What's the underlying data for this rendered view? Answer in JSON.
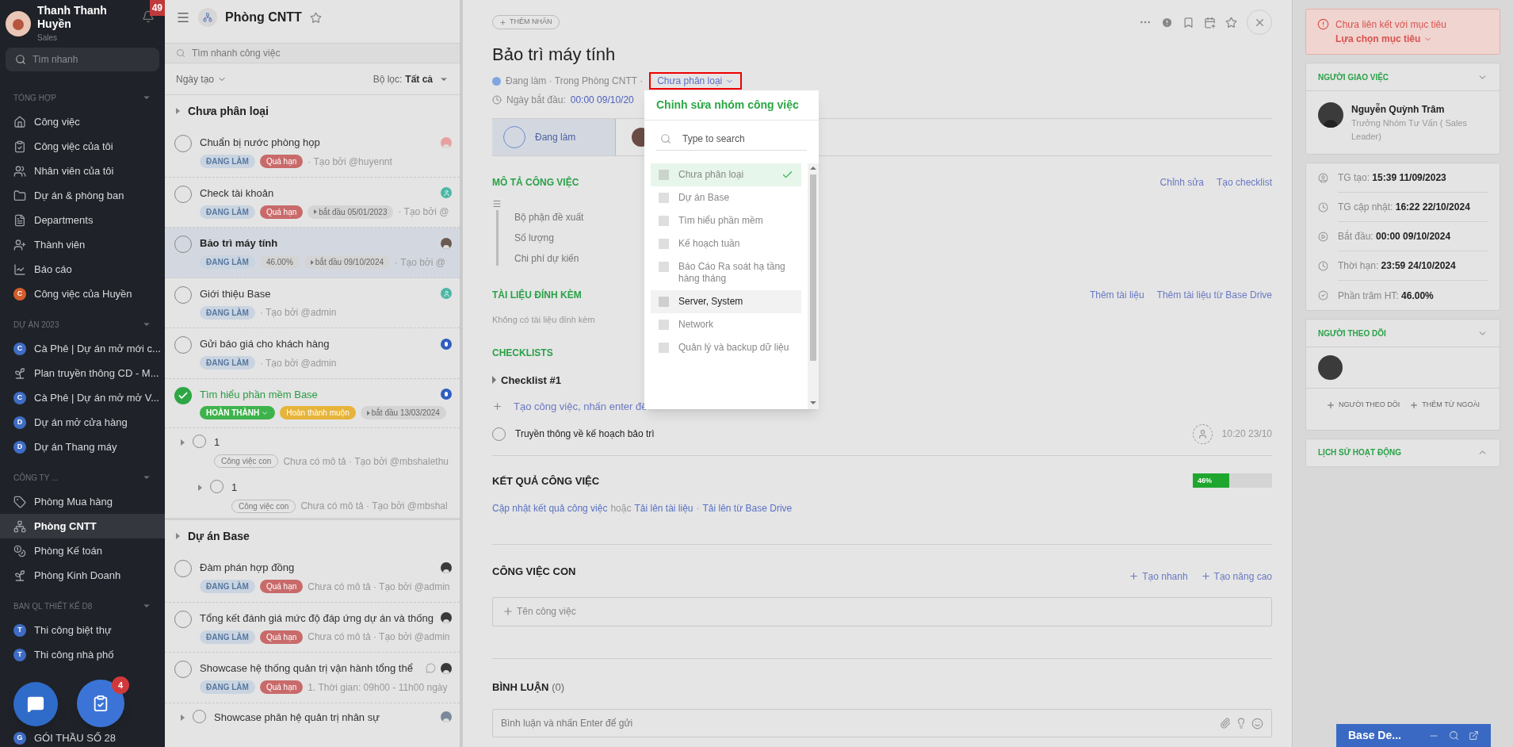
{
  "sidebar": {
    "user": {
      "name": "Thanh Thanh Huyền",
      "role": "Sales",
      "notification_count": "49"
    },
    "search": {
      "placeholder": "Tìm nhanh"
    },
    "sections": [
      {
        "title": "TỔNG HỢP",
        "items": [
          {
            "label": "Công việc",
            "kind": "home",
            "selected": false
          },
          {
            "label": "Công việc của tôi",
            "kind": "clipboard",
            "selected": false
          },
          {
            "label": "Nhân viên của tôi",
            "kind": "people",
            "selected": false
          },
          {
            "label": "Dự án & phòng ban",
            "kind": "folder",
            "selected": false
          },
          {
            "label": "Departments",
            "kind": "document",
            "selected": false
          },
          {
            "label": "Thành viên",
            "kind": "member",
            "selected": false
          },
          {
            "label": "Báo cáo",
            "kind": "chart",
            "selected": false
          },
          {
            "label": "Công việc của Huyền",
            "kind": "letter",
            "letter": "C",
            "color": "#d35d2b",
            "selected": false
          }
        ]
      },
      {
        "title": "DỰ ÁN 2023",
        "items": [
          {
            "label": "Cà Phê | Dự án mở mới c...",
            "kind": "letter",
            "letter": "C",
            "color": "#3f6cc4",
            "selected": false
          },
          {
            "label": "Plan truyền thông CD - M...",
            "kind": "plant",
            "selected": false
          },
          {
            "label": "Cà Phê | Dự án mở mở V...",
            "kind": "letter",
            "letter": "C",
            "color": "#3f6cc4",
            "selected": false
          },
          {
            "label": "Dự án mở cửa hàng",
            "kind": "letter",
            "letter": "D",
            "color": "#3f6cc4",
            "selected": false
          },
          {
            "label": "Dự án Thang máy",
            "kind": "letter",
            "letter": "D",
            "color": "#3f6cc4",
            "selected": false
          }
        ]
      },
      {
        "title": "CÔNG TY ...",
        "items": [
          {
            "label": "Phòng Mua hàng",
            "kind": "tag",
            "selected": false
          },
          {
            "label": "Phòng CNTT",
            "kind": "org",
            "selected": true
          },
          {
            "label": "Phòng Kế toán",
            "kind": "coins",
            "selected": false
          },
          {
            "label": "Phòng Kinh Doanh",
            "kind": "plant",
            "selected": false
          }
        ]
      },
      {
        "title": "BAN QL THIẾT KẾ D8",
        "items": [
          {
            "label": "Thi công biệt thự",
            "kind": "letter",
            "letter": "T",
            "color": "#3f6cc4",
            "selected": false
          },
          {
            "label": "Thi công nhà phố",
            "kind": "letter",
            "letter": "T",
            "color": "#3f6cc4",
            "selected": false
          }
        ]
      },
      {
        "items": [
          {
            "label": "GÓI THẦU SỐ 28",
            "kind": "letter",
            "letter": "G",
            "color": "#3f6cc4",
            "selected": false
          }
        ]
      }
    ],
    "floating": {
      "task_badge": "4"
    }
  },
  "task_list": {
    "title": "Phòng CNTT",
    "search": {
      "placeholder": "Tìm nhanh công việc"
    },
    "sort": "Ngày tạo",
    "filter_label": "Bộ lọc:",
    "filter_value": "Tất cả",
    "groups": [
      {
        "title": "Chưa phân loại",
        "tasks": [
          {
            "title": "Chuẩn bị nước phòng họp",
            "done": false,
            "selected": false,
            "comment": false,
            "avatar": {
              "kind": "photo",
              "color": "#e8a0a0"
            },
            "tags": [
              {
                "text": "ĐANG LÀM",
                "kind": "status"
              },
              {
                "text": "Quá hạn",
                "kind": "overdue"
              }
            ],
            "meta": "· Tạo bởi @huyennt"
          },
          {
            "title": "Check tài khoản",
            "done": false,
            "selected": false,
            "comment": false,
            "avatar": {
              "kind": "person",
              "color": "#4db6a4"
            },
            "tags": [
              {
                "text": "ĐANG LÀM",
                "kind": "status"
              },
              {
                "text": "Quá hạn",
                "kind": "overdue"
              },
              {
                "text": "bắt đầu 05/01/2023",
                "kind": "date"
              }
            ],
            "meta": "· Tạo bởi @"
          },
          {
            "title": "Bảo trì máy tính",
            "done": false,
            "selected": true,
            "comment": false,
            "avatar": {
              "kind": "photo",
              "color": "#6b5a52"
            },
            "tags": [
              {
                "text": "ĐANG LÀM",
                "kind": "status"
              },
              {
                "text": "46.00%",
                "kind": "percent"
              },
              {
                "text": "bắt đầu 09/10/2024",
                "kind": "date"
              }
            ],
            "meta": "· Tạo bởi @"
          },
          {
            "title": "Giới thiệu Base",
            "done": false,
            "selected": false,
            "comment": false,
            "avatar": {
              "kind": "person",
              "color": "#4db6a4"
            },
            "tags": [
              {
                "text": "ĐANG LÀM",
                "kind": "status"
              }
            ],
            "meta": "· Tạo bởi @admin"
          },
          {
            "title": "Gửi báo giá cho khách hàng",
            "done": false,
            "selected": false,
            "comment": false,
            "avatar": {
              "kind": "logo",
              "color": "#2f5fbf"
            },
            "tags": [
              {
                "text": "ĐANG LÀM",
                "kind": "status"
              }
            ],
            "meta": "· Tạo bởi @admin"
          },
          {
            "title": "Tìm hiểu phần mềm Base",
            "done": true,
            "selected": false,
            "comment": false,
            "avatar": {
              "kind": "logo",
              "color": "#2f5fbf"
            },
            "tags": [
              {
                "text": "HOÀN THÀNH",
                "kind": "done"
              },
              {
                "text": "Hoàn thành muộn",
                "kind": "late"
              },
              {
                "text": "bắt đầu 13/03/2024",
                "kind": "date"
              }
            ],
            "children": [
              {
                "title": "1",
                "done": false,
                "selected": false,
                "comment": false,
                "tags": [
                  {
                    "text": "Công việc con",
                    "kind": "subtask"
                  }
                ],
                "meta": "Chưa có mô tả · Tạo bởi @mbshalethu",
                "children": [
                  {
                    "title": "1",
                    "done": false,
                    "selected": false,
                    "comment": false,
                    "tags": [
                      {
                        "text": "Công việc con",
                        "kind": "subtask"
                      }
                    ],
                    "meta": "Chưa có mô tả · Tạo bởi @mbshal"
                  }
                ]
              }
            ]
          }
        ]
      },
      {
        "title": "Dự án Base",
        "tasks": [
          {
            "title": "Đàm phán hợp đồng",
            "done": false,
            "selected": false,
            "comment": false,
            "avatar": {
              "kind": "photo",
              "color": "#3a3a3a"
            },
            "tags": [
              {
                "text": "ĐANG LÀM",
                "kind": "status"
              },
              {
                "text": "Quá hạn",
                "kind": "overdue"
              }
            ],
            "meta": "Chưa có mô tả · Tạo bởi @admin"
          },
          {
            "title": "Tổng kết đánh giá mức độ đáp ứng dự án và thống",
            "done": false,
            "selected": false,
            "comment": false,
            "avatar": {
              "kind": "photo",
              "color": "#3a3a3a"
            },
            "tags": [
              {
                "text": "ĐANG LÀM",
                "kind": "status"
              },
              {
                "text": "Quá hạn",
                "kind": "overdue"
              }
            ],
            "meta": "Chưa có mô tả · Tạo bởi @admin"
          },
          {
            "title": "Showcase hệ thống quản trị vận hành tổng thể",
            "done": false,
            "selected": false,
            "comment": true,
            "avatar": {
              "kind": "photo",
              "color": "#3a3a3a"
            },
            "tags": [
              {
                "text": "ĐANG LÀM",
                "kind": "status"
              },
              {
                "text": "Quá hạn",
                "kind": "overdue"
              }
            ],
            "meta": "1. Thời gian: 09h00 - 11h00 ngày",
            "children": [
              {
                "title": "Showcase phân hệ quản trị nhân sự",
                "done": false,
                "selected": false,
                "comment": false,
                "avatar": {
                  "kind": "photo",
                  "color": "#7a8a9a"
                }
              }
            ]
          }
        ]
      }
    ]
  },
  "detail": {
    "add_label": "THÊM NHÃN",
    "title": "Bảo trì máy tính",
    "status_dot": {
      "color": "#7fa6e0"
    },
    "status_text": "Đang làm · Trong Phòng CNTT ·",
    "group": "Chưa phân loại",
    "start_label": "Ngày bắt đầu:",
    "start_value": "00:00 09/10/20",
    "status_block": "Đang làm",
    "description": {
      "title": "MÔ TẢ CÔNG VIỆC",
      "actions": [
        "Chỉnh sửa",
        "Tạo checklist"
      ],
      "lines": [
        "Bộ phận đề xuất",
        "Số lượng",
        "Chi phí dự kiến"
      ]
    },
    "attachments": {
      "title": "TÀI LIỆU ĐÍNH KÈM",
      "actions": [
        "Thêm tài liệu",
        "Thêm tài liệu từ Base Drive"
      ],
      "empty": "Không có tài liệu đính kèm"
    },
    "checklists": {
      "title": "CHECKLISTS",
      "name": "Checklist #1",
      "add": "Tạo công việc, nhấn enter để",
      "items": [
        {
          "text": "Truyền thông về kế hoạch bảo trì",
          "checked": false,
          "time": "10:20 23/10"
        }
      ]
    },
    "result": {
      "title": "KẾT QUẢ CÔNG VIỆC",
      "level": 0.46,
      "reading": "46%",
      "update": "Cập nhật kết quả công việc",
      "or": "hoặc",
      "upload": "Tải lên tài liệu",
      "sep": "·",
      "drive": "Tải lên từ Base Drive"
    },
    "subtasks": {
      "title": "CÔNG VIỆC CON",
      "actions": [
        "Tạo nhanh",
        "Tạo nâng cao"
      ],
      "placeholder": "Tên công việc"
    },
    "comments": {
      "title": "BÌNH LUẬN",
      "count": "(0)",
      "placeholder": "Bình luận và nhấn Enter để gửi"
    }
  },
  "group_menu": {
    "title": "Chỉnh sửa nhóm công việc",
    "search": {
      "placeholder": "Type to search"
    },
    "options": [
      {
        "label": "Chưa phân loại",
        "selected": true,
        "highlighted": false
      },
      {
        "label": "Dự án Base",
        "selected": false,
        "highlighted": false
      },
      {
        "label": "Tìm hiểu phần mềm",
        "selected": false,
        "highlighted": false
      },
      {
        "label": "Kế hoạch tuần",
        "selected": false,
        "highlighted": false
      },
      {
        "label": "Báo Cáo Ra soát hạ tầng hàng tháng",
        "selected": false,
        "highlighted": false
      },
      {
        "label": "Server, System",
        "selected": false,
        "highlighted": true
      },
      {
        "label": "Network",
        "selected": false,
        "highlighted": false
      },
      {
        "label": "Quản lý và backup dữ liệu",
        "selected": false,
        "highlighted": false
      }
    ]
  },
  "side_panel": {
    "goal_alert": {
      "text": "Chưa liên kết với mục tiêu",
      "link": "Lựa chọn mục tiêu"
    },
    "assigner": {
      "title": "NGƯỜI GIAO VIỆC",
      "expanded": true,
      "name": "Nguyễn Quỳnh Trâm",
      "role": "Trưởng Nhóm Tư Vấn ( Sales Leader)"
    },
    "info": [
      {
        "kind": "user",
        "label": "TG tạo:",
        "value": "15:39 11/09/2023"
      },
      {
        "kind": "clock",
        "label": "TG cập nhật:",
        "value": "16:22 22/10/2024"
      },
      {
        "kind": "play",
        "label": "Bắt đầu:",
        "value": "00:00 09/10/2024"
      },
      {
        "kind": "clock",
        "label": "Thời hạn:",
        "value": "23:59 24/10/2024"
      },
      {
        "kind": "check",
        "label": "Phần trăm HT:",
        "value": "46.00%"
      }
    ],
    "followers": {
      "title": "NGƯỜI THEO DÕI",
      "expanded": true,
      "actions": [
        "NGƯỜI THEO DÕI",
        "THÊM TỪ NGOÀI"
      ]
    },
    "history": {
      "title": "LỊCH SỬ HOẠT ĐỘNG",
      "expanded": false
    },
    "chat": {
      "title": "Base De..."
    }
  }
}
